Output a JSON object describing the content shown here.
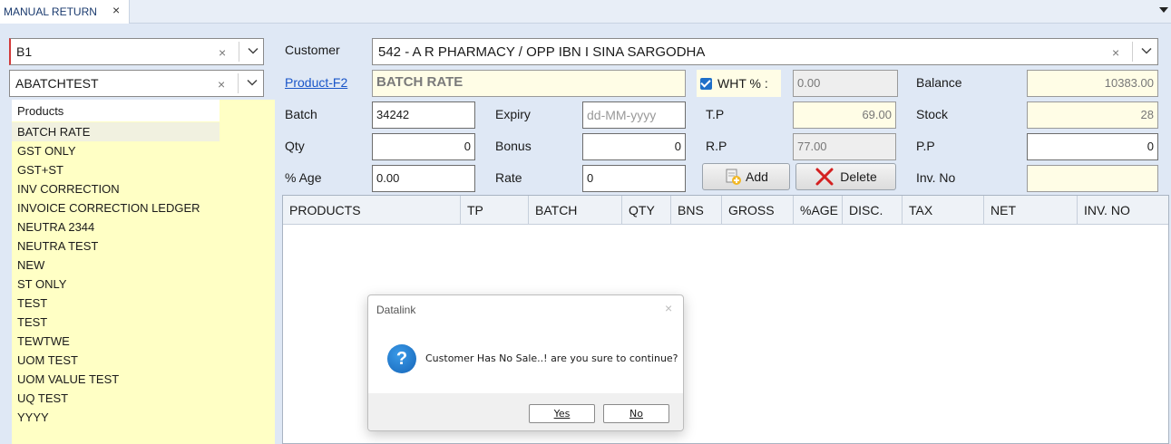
{
  "tab": {
    "title": "MANUAL RETURN",
    "close": "×"
  },
  "combo_batch": {
    "value": "B1",
    "clear": "×"
  },
  "combo_product": {
    "value": "ABATCHTEST",
    "clear": "×"
  },
  "product_list": {
    "header": "Products",
    "items": [
      "BATCH RATE",
      "GST ONLY",
      "GST+ST",
      "INV CORRECTION",
      "INVOICE CORRECTION LEDGER",
      "NEUTRA 2344",
      "NEUTRA TEST",
      "NEW",
      "ST ONLY",
      "TEST",
      "TEST",
      "TEWTWE",
      "UOM TEST",
      "UOM VALUE TEST",
      "UQ TEST",
      "YYYY"
    ]
  },
  "customer": {
    "label": "Customer",
    "value": "542 - A R PHARMACY / OPP IBN I SINA  SARGODHA",
    "clear": "×"
  },
  "product": {
    "label": "Product-F2",
    "value": "BATCH RATE"
  },
  "wht": {
    "label": "WHT % :",
    "value": "0.00"
  },
  "balance": {
    "label": "Balance",
    "value": "10383.00"
  },
  "batch": {
    "label": "Batch",
    "value": "34242"
  },
  "expiry": {
    "label": "Expiry",
    "placeholder": "dd-MM-yyyy"
  },
  "tp": {
    "label": "T.P",
    "value": "69.00"
  },
  "stock": {
    "label": "Stock",
    "value": "28"
  },
  "qty": {
    "label": "Qty",
    "value": "0"
  },
  "bonus": {
    "label": "Bonus",
    "value": "0"
  },
  "rp": {
    "label": "R.P",
    "value": "77.00"
  },
  "pp": {
    "label": "P.P",
    "value": "0"
  },
  "age": {
    "label": "% Age",
    "value": "0.00"
  },
  "rate": {
    "label": "Rate",
    "value": "0"
  },
  "buttons": {
    "add": "Add",
    "delete": "Delete"
  },
  "invno": {
    "label": "Inv. No",
    "value": ""
  },
  "grid": {
    "columns": [
      "PRODUCTS",
      "TP",
      "BATCH",
      "QTY",
      "BNS",
      "GROSS",
      "%AGE",
      "DISC.",
      "TAX",
      "NET",
      "INV. NO"
    ]
  },
  "dialog": {
    "title": "Datalink",
    "close": "×",
    "icon": "?",
    "message": "Customer Has No Sale..! are you sure to continue?",
    "yes": "Yes",
    "no": "No"
  },
  "colors": {
    "accent": "#1f6fc9",
    "list_bg": "#ffffc5",
    "readonly_yellow": "#fffde6"
  }
}
